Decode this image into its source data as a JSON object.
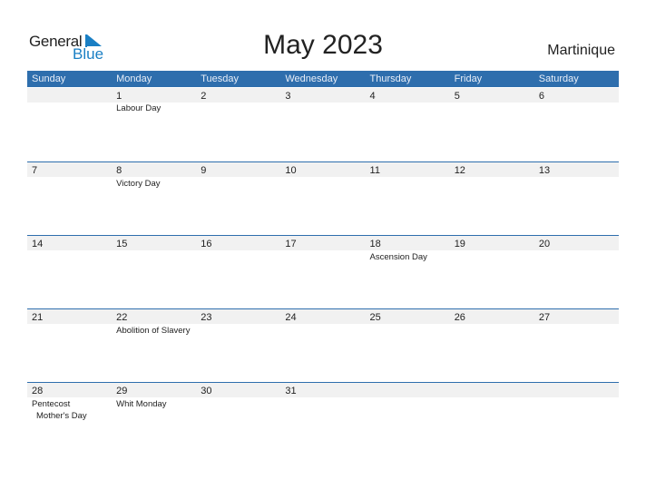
{
  "logo": {
    "general": "General",
    "blue": "Blue"
  },
  "title": "May 2023",
  "country": "Martinique",
  "accent_color": "#2e6ead",
  "weekdays": [
    "Sunday",
    "Monday",
    "Tuesday",
    "Wednesday",
    "Thursday",
    "Friday",
    "Saturday"
  ],
  "weeks": [
    [
      {
        "day": "",
        "events": []
      },
      {
        "day": "1",
        "events": [
          "Labour Day"
        ]
      },
      {
        "day": "2",
        "events": []
      },
      {
        "day": "3",
        "events": []
      },
      {
        "day": "4",
        "events": []
      },
      {
        "day": "5",
        "events": []
      },
      {
        "day": "6",
        "events": []
      }
    ],
    [
      {
        "day": "7",
        "events": []
      },
      {
        "day": "8",
        "events": [
          "Victory Day"
        ]
      },
      {
        "day": "9",
        "events": []
      },
      {
        "day": "10",
        "events": []
      },
      {
        "day": "11",
        "events": []
      },
      {
        "day": "12",
        "events": []
      },
      {
        "day": "13",
        "events": []
      }
    ],
    [
      {
        "day": "14",
        "events": []
      },
      {
        "day": "15",
        "events": []
      },
      {
        "day": "16",
        "events": []
      },
      {
        "day": "17",
        "events": []
      },
      {
        "day": "18",
        "events": [
          "Ascension Day"
        ]
      },
      {
        "day": "19",
        "events": []
      },
      {
        "day": "20",
        "events": []
      }
    ],
    [
      {
        "day": "21",
        "events": []
      },
      {
        "day": "22",
        "events": [
          "Abolition of Slavery"
        ]
      },
      {
        "day": "23",
        "events": []
      },
      {
        "day": "24",
        "events": []
      },
      {
        "day": "25",
        "events": []
      },
      {
        "day": "26",
        "events": []
      },
      {
        "day": "27",
        "events": []
      }
    ],
    [
      {
        "day": "28",
        "events": [
          "Pentecost",
          "Mother's Day"
        ]
      },
      {
        "day": "29",
        "events": [
          "Whit Monday"
        ]
      },
      {
        "day": "30",
        "events": []
      },
      {
        "day": "31",
        "events": []
      },
      {
        "day": "",
        "events": []
      },
      {
        "day": "",
        "events": []
      },
      {
        "day": "",
        "events": []
      }
    ]
  ]
}
